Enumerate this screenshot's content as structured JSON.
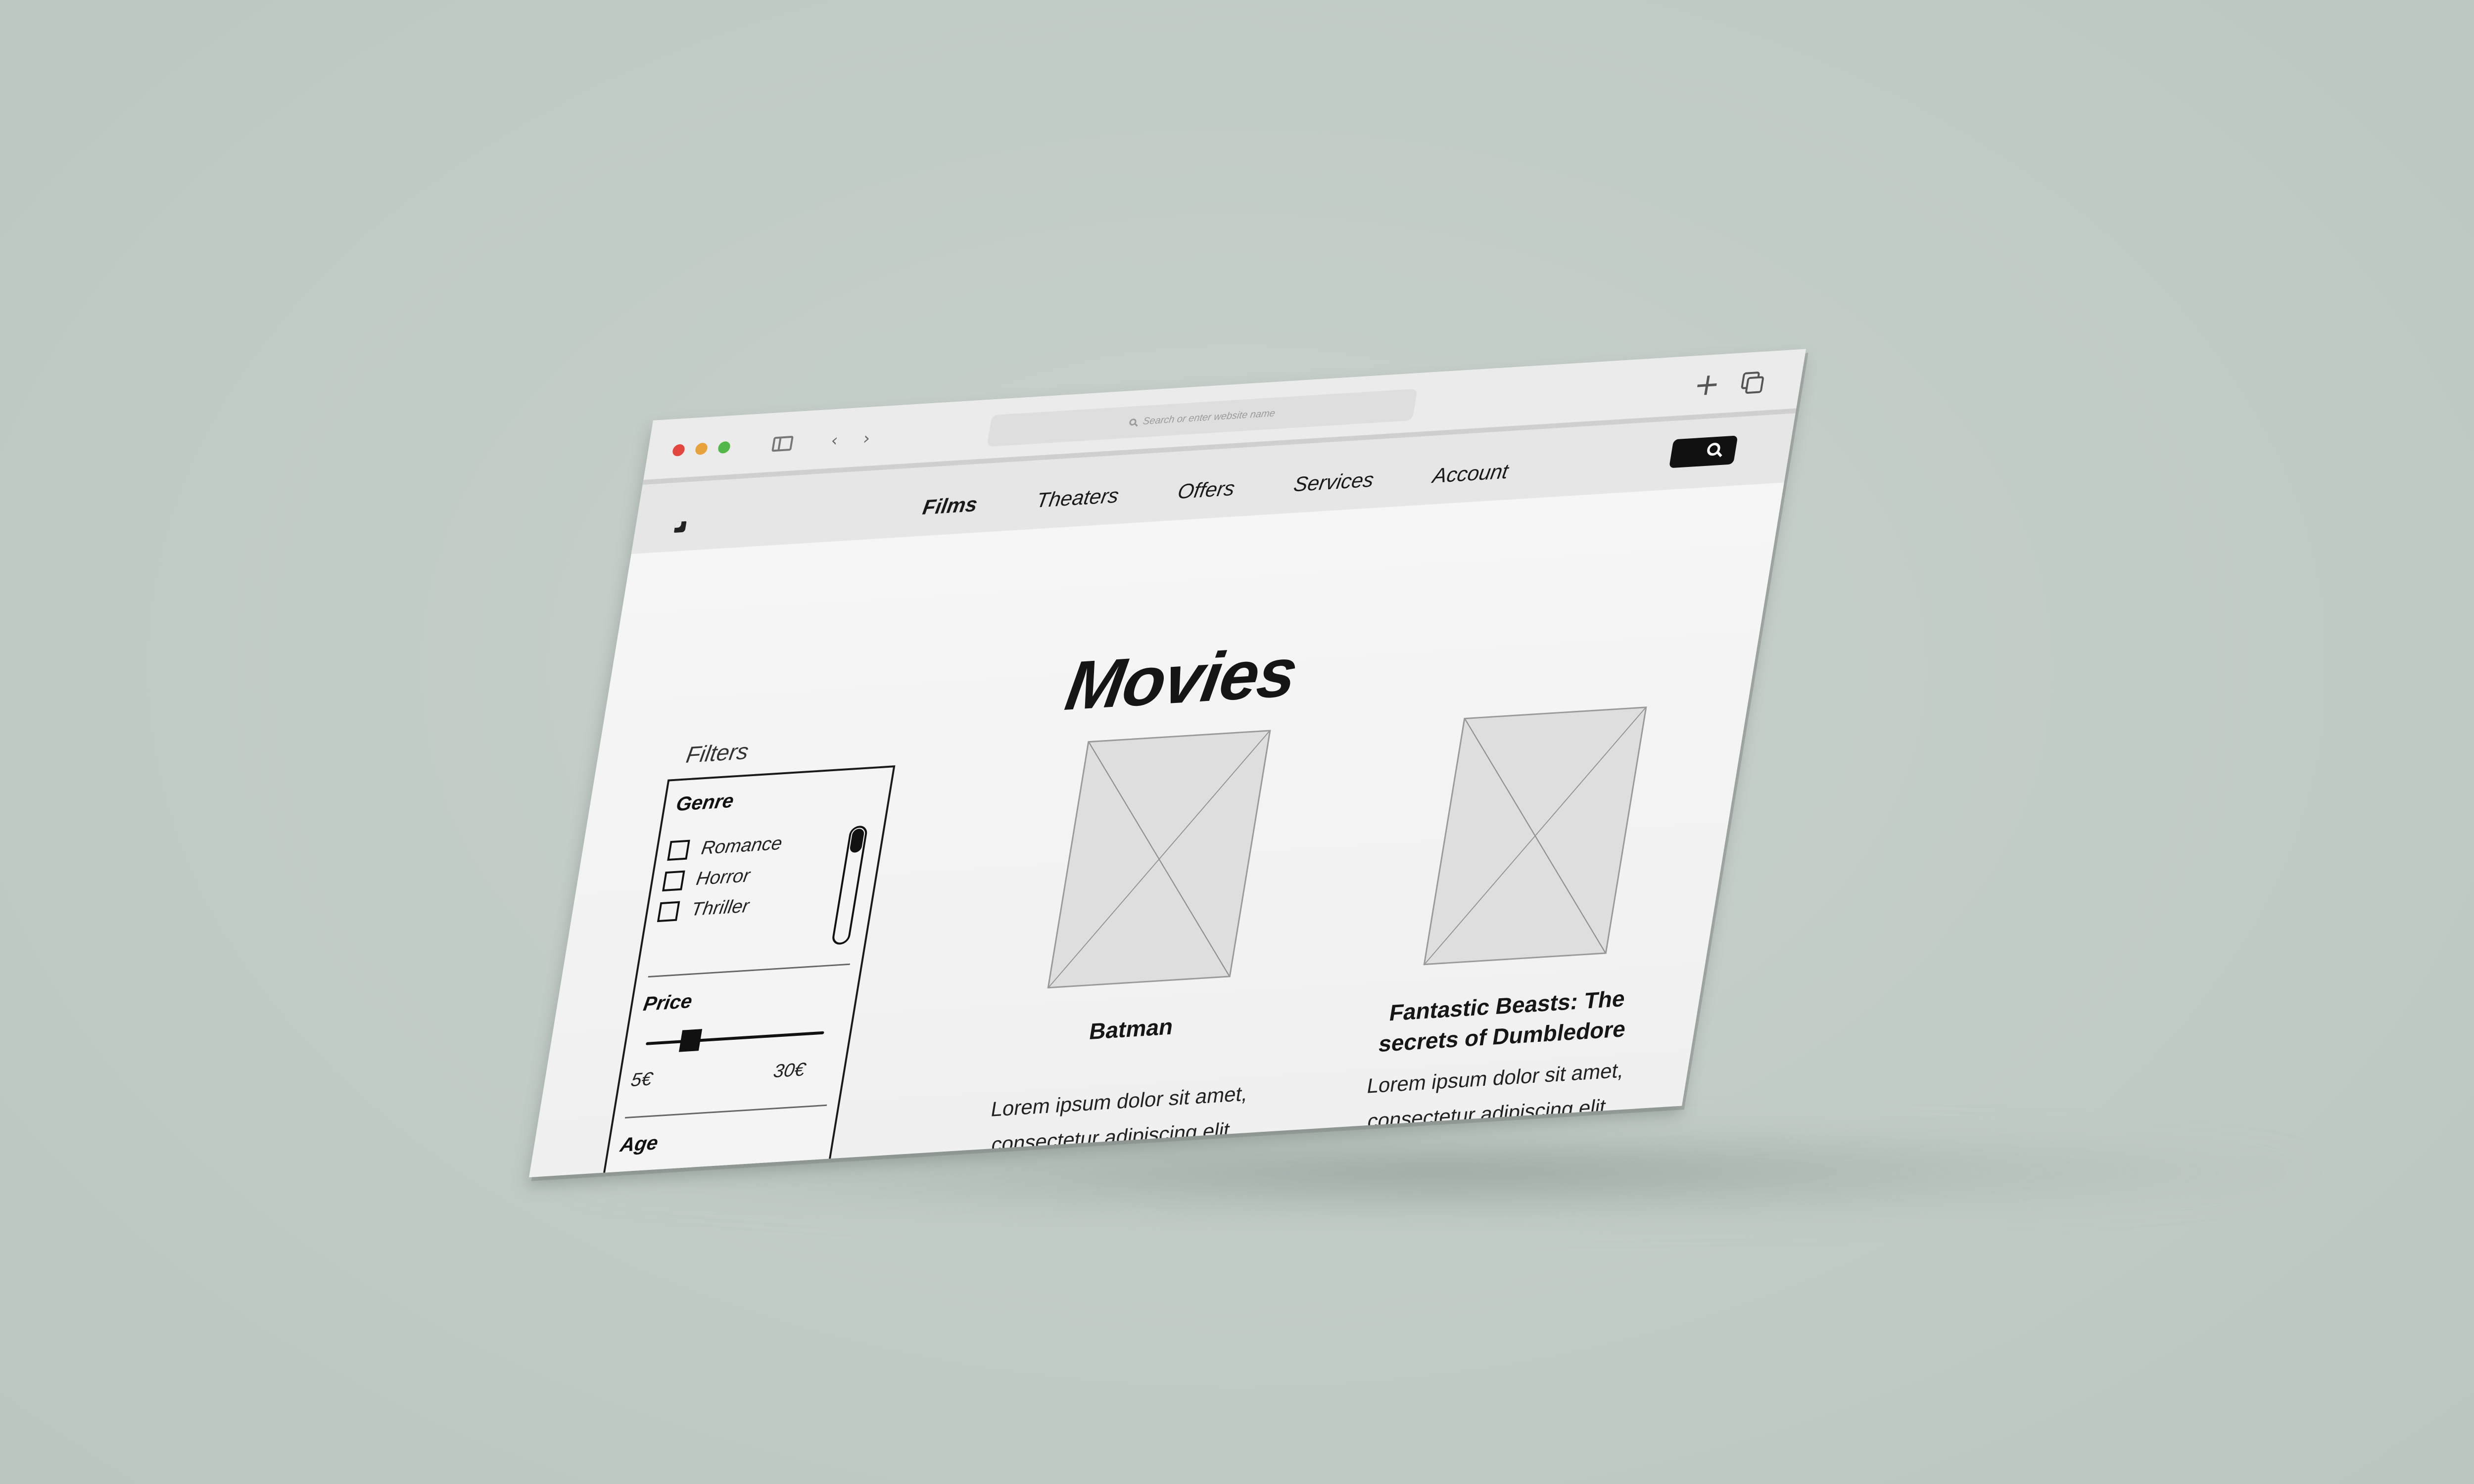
{
  "browser": {
    "address_placeholder": "Search or enter website name",
    "traffic_lights": {
      "close": "#e2463f",
      "minimize": "#e7a23c",
      "zoom": "#53b847"
    },
    "icons": [
      "sidebar-toggle-icon",
      "back-arrow-icon",
      "forward-arrow-icon",
      "plus-icon",
      "tabs-overview-icon"
    ]
  },
  "site": {
    "nav": {
      "items": [
        {
          "label": "Films",
          "active": true
        },
        {
          "label": "Theaters",
          "active": false
        },
        {
          "label": "Offers",
          "active": false
        },
        {
          "label": "Services",
          "active": false
        },
        {
          "label": "Account",
          "active": false
        }
      ],
      "search_icon": "search-icon"
    },
    "page_title": "Movies",
    "filters": {
      "heading": "Filters",
      "genre": {
        "label": "Genre",
        "options": [
          {
            "label": "Romance",
            "checked": false
          },
          {
            "label": "Horror",
            "checked": false
          },
          {
            "label": "Thriller",
            "checked": false
          }
        ]
      },
      "price": {
        "label": "Price",
        "min": "5€",
        "max": "30€",
        "slider_value": 0.25
      },
      "age": {
        "label": "Age"
      }
    },
    "movies": [
      {
        "title": "Batman",
        "description_lines": [
          "Lorem ipsum dolor sit amet,",
          "consectetur adipiscing elit."
        ]
      },
      {
        "title_lines": [
          "Fantastic Beasts: The",
          "secrets of Dumbledore"
        ],
        "description_lines": [
          "Lorem ipsum dolor sit amet,",
          "consectetur adipiscing elit."
        ]
      }
    ]
  }
}
